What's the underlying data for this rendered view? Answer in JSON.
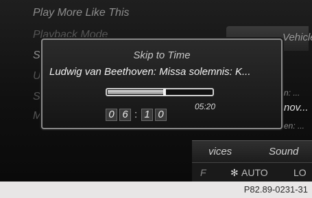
{
  "background_menu": {
    "items": [
      "Play More Like This",
      "Playback Mode",
      "S",
      "U",
      "S",
      "M"
    ],
    "right_panel_label": "Vehicle",
    "right_fragments": [
      "n: ...",
      "nov...",
      "en: ..."
    ]
  },
  "bottom_tabs": {
    "left": "vices",
    "right": "Sound"
  },
  "bottom_bar": {
    "left_icon": "fan-icon",
    "auto_label": "AUTO",
    "right": "LO",
    "left_frag": "F"
  },
  "dialog": {
    "title": "Skip to Time",
    "track": "Ludwig van Beethoven: Missa solemnis: K...",
    "total_time": "05:20",
    "progress_fraction": 0.55,
    "time_digits": [
      "0",
      "6",
      "1",
      "0"
    ]
  },
  "caption": "P82.89-0231-31"
}
